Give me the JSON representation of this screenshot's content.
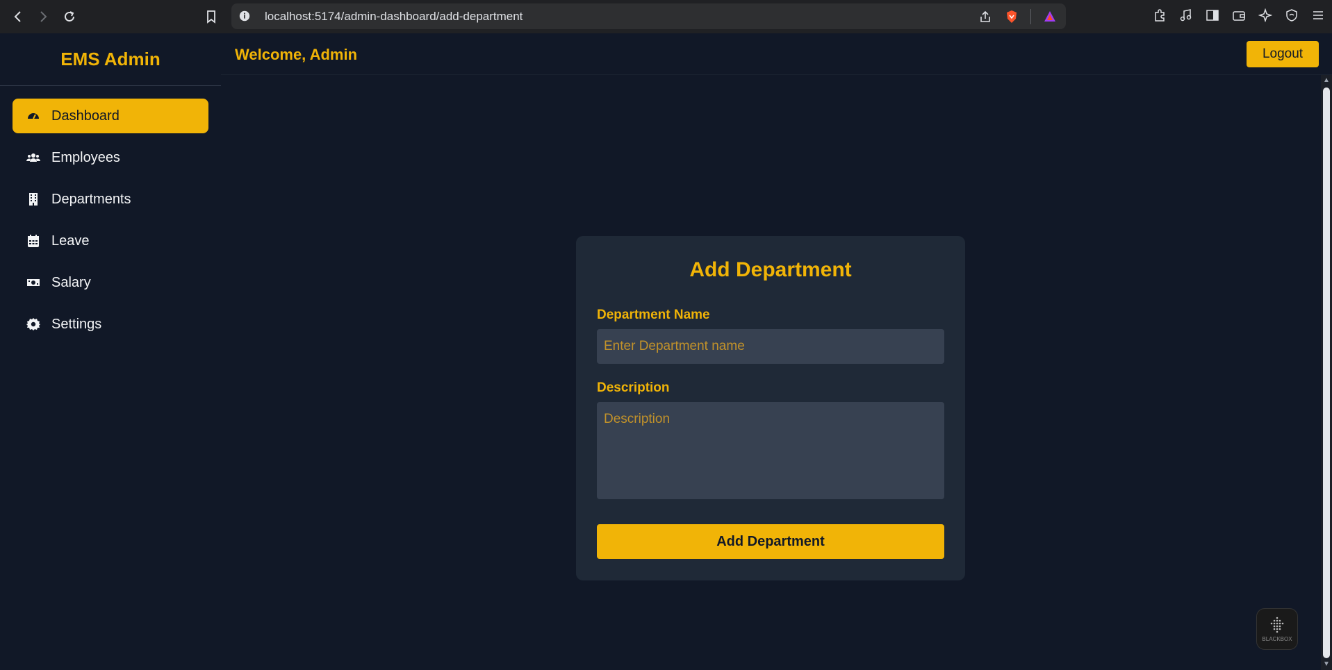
{
  "browser": {
    "url": "localhost:5174/admin-dashboard/add-department"
  },
  "sidebar": {
    "brand": "EMS Admin",
    "items": [
      {
        "label": "Dashboard",
        "icon": "gauge-icon",
        "active": true
      },
      {
        "label": "Employees",
        "icon": "users-icon",
        "active": false
      },
      {
        "label": "Departments",
        "icon": "building-icon",
        "active": false
      },
      {
        "label": "Leave",
        "icon": "calendar-icon",
        "active": false
      },
      {
        "label": "Salary",
        "icon": "money-icon",
        "active": false
      },
      {
        "label": "Settings",
        "icon": "gear-icon",
        "active": false
      }
    ]
  },
  "header": {
    "welcome": "Welcome, Admin",
    "logout_label": "Logout"
  },
  "form": {
    "title": "Add Department",
    "name_label": "Department Name",
    "name_placeholder": "Enter Department name",
    "name_value": "",
    "description_label": "Description",
    "description_placeholder": "Description",
    "description_value": "",
    "submit_label": "Add Department"
  },
  "widget": {
    "label": "BLACKBOX"
  },
  "colors": {
    "accent": "#f1b407",
    "background": "#111827",
    "card": "#1f2937",
    "input": "#374151"
  }
}
